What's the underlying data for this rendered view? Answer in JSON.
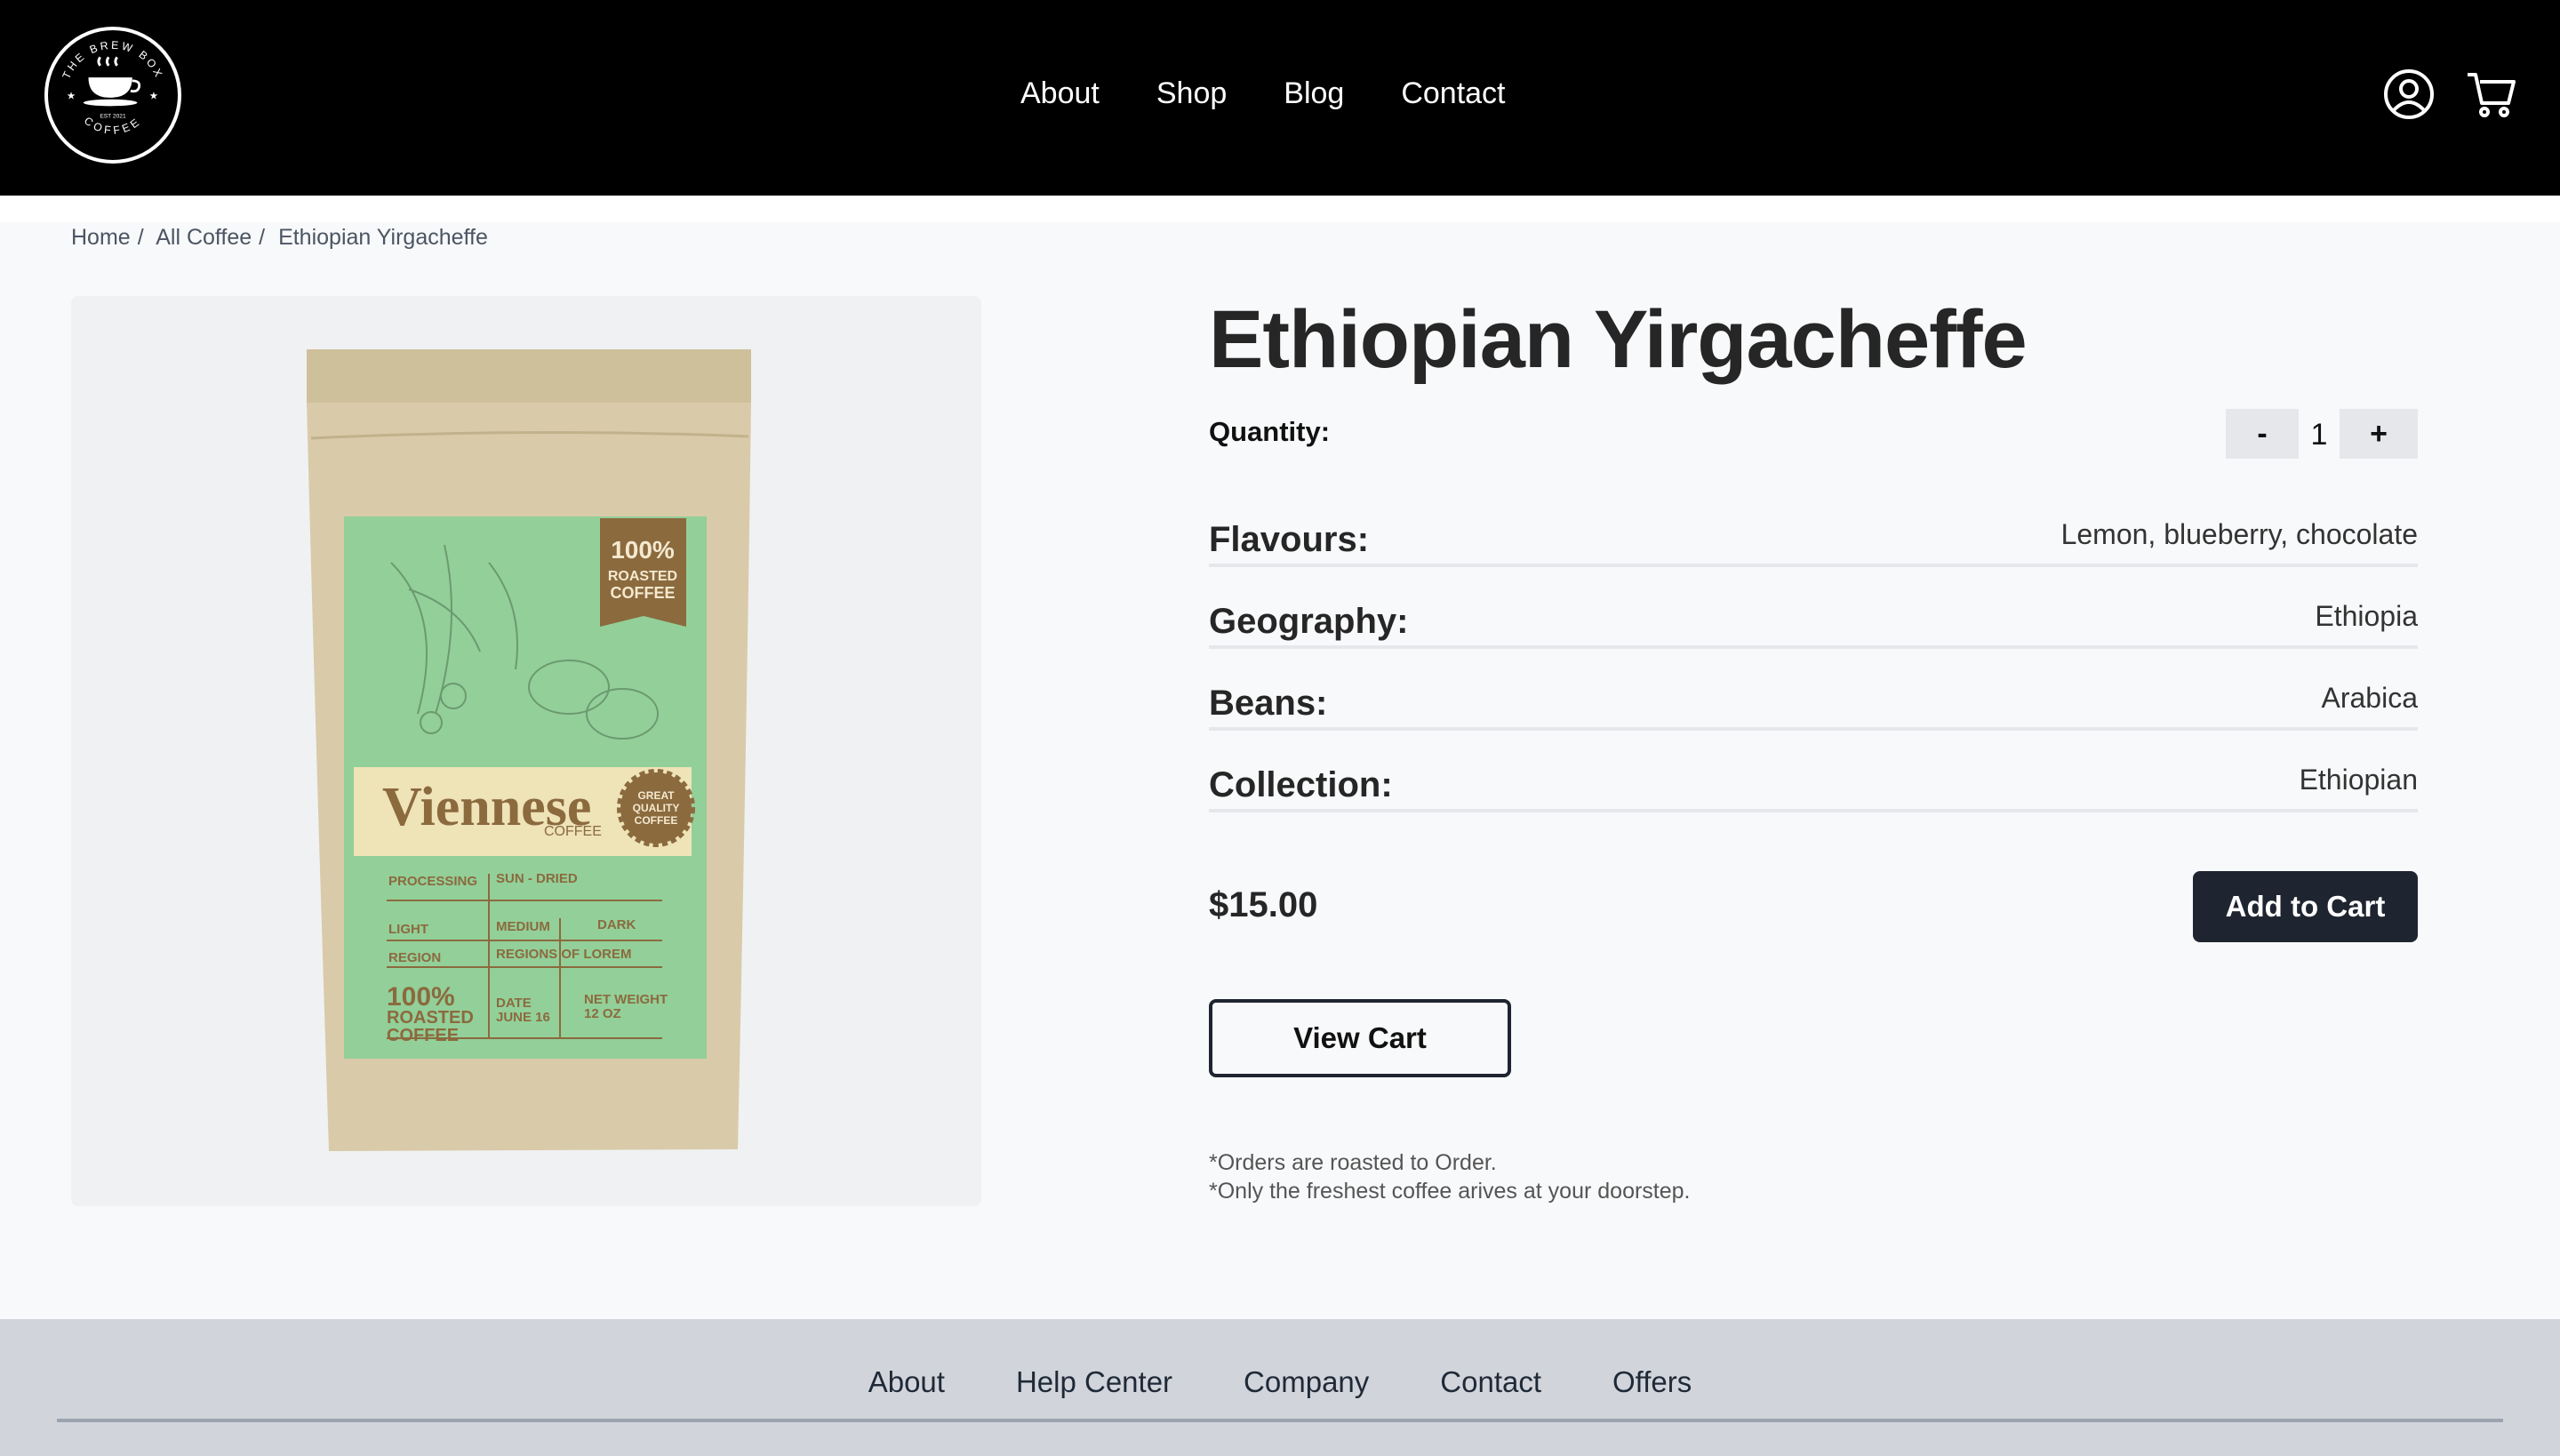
{
  "header": {
    "logo_text": {
      "top": "THE BREW BOX",
      "bottom": "COFFEE",
      "est": "EST 2021"
    },
    "nav": [
      {
        "label": "About"
      },
      {
        "label": "Shop"
      },
      {
        "label": "Blog"
      },
      {
        "label": "Contact"
      }
    ],
    "icons": [
      "user-icon",
      "cart-icon"
    ]
  },
  "breadcrumb": {
    "items": [
      "Home",
      "All Coffee",
      "Ethiopian Yirgacheffe"
    ],
    "separator": "/"
  },
  "product": {
    "title": "Ethiopian Yirgacheffe",
    "quantity_label": "Quantity:",
    "quantity": "1",
    "minus_label": "-",
    "plus_label": "+",
    "attributes": [
      {
        "label": "Flavours:",
        "value": "Lemon, blueberry, chocolate"
      },
      {
        "label": "Geography:",
        "value": "Ethiopia"
      },
      {
        "label": "Beans:",
        "value": "Arabica"
      },
      {
        "label": "Collection:",
        "value": "Ethiopian"
      }
    ],
    "price": "$15.00",
    "add_to_cart_label": "Add to Cart",
    "view_cart_label": "View Cart",
    "notes": [
      "*Orders are roasted to Order.",
      "*Only the freshest coffee arives at your doorstep."
    ],
    "image_text": {
      "badge": [
        "100%",
        "ROASTED",
        "COFFEE"
      ],
      "brand": "Viennese",
      "brand_sub": "COFFEE",
      "seal": [
        "GREAT",
        "QUALITY",
        "COFFEE"
      ],
      "processing": "PROCESSING",
      "sun_dried": "SUN - DRIED",
      "light": "LIGHT",
      "medium": "MEDIUM",
      "dark": "DARK",
      "region": "REGION",
      "regions_of_lorem": "REGIONS OF LOREM",
      "footer_badge": [
        "100%",
        "ROASTED",
        "COFFEE"
      ],
      "date": [
        "DATE",
        "JUNE 16"
      ],
      "net_weight": [
        "NET WEIGHT",
        "12 OZ"
      ]
    }
  },
  "footer": {
    "links": [
      "About",
      "Help Center",
      "Company",
      "Contact",
      "Offers"
    ]
  },
  "colors": {
    "header_bg": "#000000",
    "button_dark": "#1f2530",
    "footer_bg": "#d1d5db",
    "bag_kraft": "#d8c9a8",
    "label_green": "#93cf99",
    "brand_brown": "#8b6a3e"
  }
}
